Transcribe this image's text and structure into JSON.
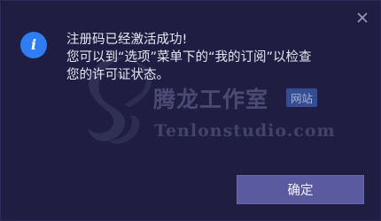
{
  "dialog": {
    "close_icon": "close-icon",
    "info_icon": "info-icon",
    "info_glyph": "i",
    "message_lines": [
      "注册码已经激活成功!",
      "您可以到“选项”菜单下的“我的订阅”以检查",
      "您的许可证状态。"
    ],
    "ok_label": "确定"
  },
  "watermark": {
    "title": "腾龙工作室",
    "badge": "网站",
    "domain": "Tenlonstudio.com",
    "logo_icon": "dragon-logo-icon"
  },
  "colors": {
    "background": "#1f1e42",
    "info_icon": "#2f7df0",
    "button": "#5b5a9e",
    "text": "#e6e6f2"
  }
}
